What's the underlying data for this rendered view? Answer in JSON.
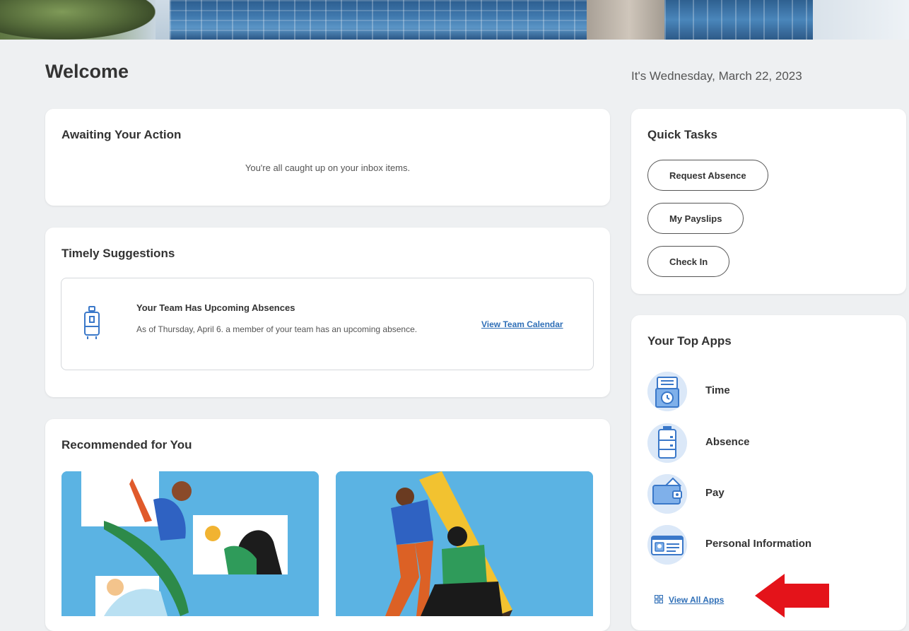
{
  "header": {
    "welcome": "Welcome",
    "date": "It's Wednesday, March 22, 2023"
  },
  "awaiting": {
    "title": "Awaiting Your Action",
    "empty_message": "You're all caught up on your inbox items."
  },
  "timely": {
    "title": "Timely Suggestions",
    "suggestion": {
      "icon": "luggage-icon",
      "title": "Your Team Has Upcoming Absences",
      "description": "As of Thursday, April 6. a member of your team has an upcoming absence.",
      "link": "View Team Calendar"
    }
  },
  "recommended": {
    "title": "Recommended for You"
  },
  "quick_tasks": {
    "title": "Quick Tasks",
    "buttons": [
      "Request Absence",
      "My Payslips",
      "Check In"
    ]
  },
  "top_apps": {
    "title": "Your Top Apps",
    "apps": [
      {
        "label": "Time",
        "icon": "time-clock-icon"
      },
      {
        "label": "Absence",
        "icon": "suitcase-icon"
      },
      {
        "label": "Pay",
        "icon": "wallet-icon"
      },
      {
        "label": "Personal Information",
        "icon": "id-card-icon"
      }
    ],
    "view_all": "View All Apps"
  },
  "colors": {
    "accent": "#2f6fb7",
    "background": "#eef0f2",
    "illustration_sky": "#5bb3e3",
    "annotation_arrow": "#e4131a"
  }
}
